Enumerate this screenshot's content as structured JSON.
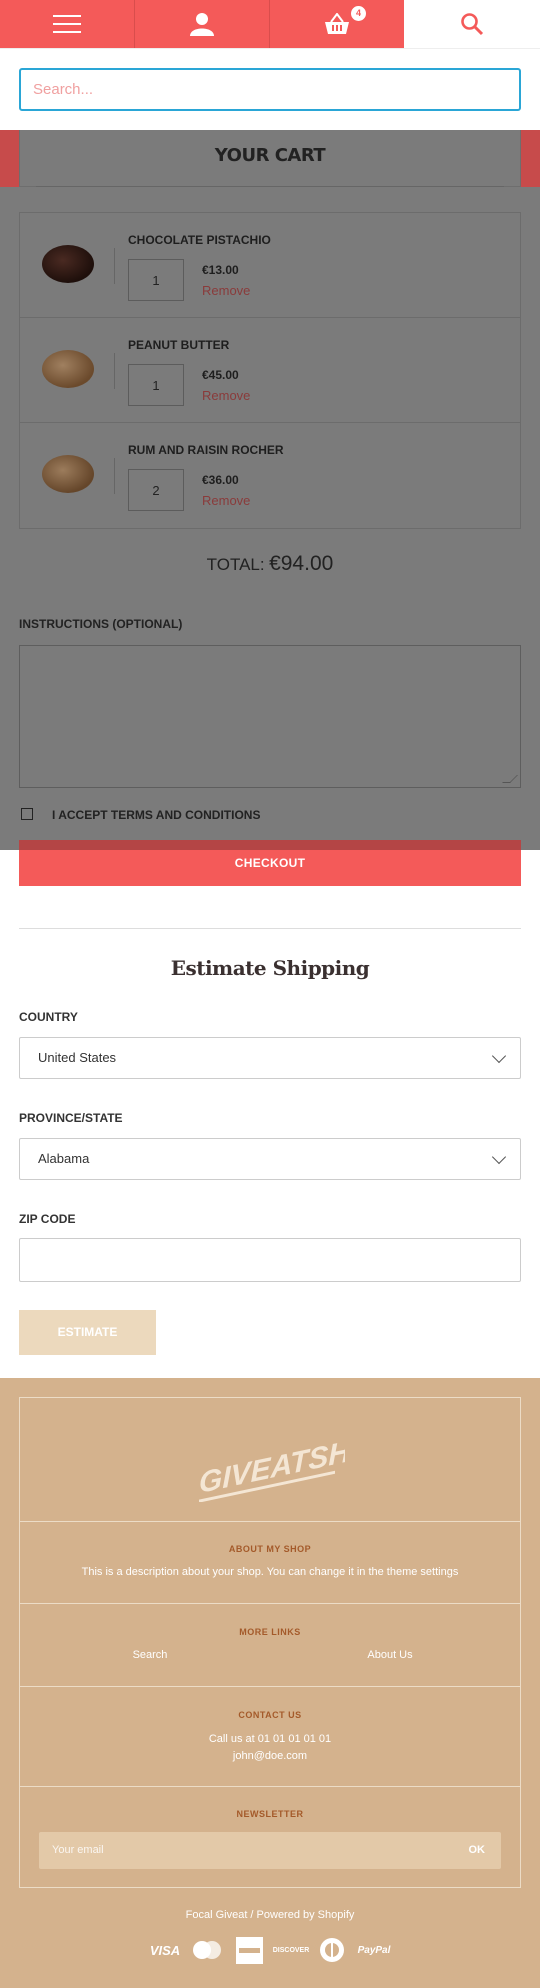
{
  "nav": {
    "cart_count": "4"
  },
  "search": {
    "placeholder": "Search..."
  },
  "cart": {
    "title": "YOUR CART",
    "items": [
      {
        "name": "CHOCOLATE PISTACHIO",
        "qty": "1",
        "price": "€13.00",
        "remove": "Remove"
      },
      {
        "name": "PEANUT BUTTER",
        "qty": "1",
        "price": "€45.00",
        "remove": "Remove"
      },
      {
        "name": "RUM AND RAISIN ROCHER",
        "qty": "2",
        "price": "€36.00",
        "remove": "Remove"
      }
    ],
    "total_label": "TOTAL:",
    "total_value": "€94.00",
    "instructions_label": "INSTRUCTIONS (OPTIONAL)",
    "terms_label": "I ACCEPT TERMS AND CONDITIONS",
    "checkout_label": "CHECKOUT"
  },
  "shipping": {
    "title": "Estimate Shipping",
    "country_label": "COUNTRY",
    "country_value": "United States",
    "province_label": "PROVINCE/STATE",
    "province_value": "Alabama",
    "zip_label": "ZIP CODE",
    "estimate_label": "ESTIMATE"
  },
  "footer": {
    "logo_text": "GIVEATSHOP",
    "about_title": "ABOUT MY SHOP",
    "about_text": "This is a description about your shop. You can change it in the theme settings",
    "links_title": "MORE LINKS",
    "link_search": "Search",
    "link_about": "About Us",
    "contact_title": "CONTACT US",
    "contact_phone": "Call us at 01 01 01 01 01",
    "contact_email": "john@doe.com",
    "newsletter_title": "NEWSLETTER",
    "newsletter_placeholder": "Your email",
    "newsletter_ok": "OK",
    "powered": "Focal Giveat / Powered by Shopify",
    "payments": [
      "VISA",
      "MasterCard",
      "AMERICAN EXPRESS",
      "DISCOVER",
      "Diners Club",
      "PayPal"
    ]
  },
  "colors": {
    "brand_red": "#f45a59",
    "footer_tan": "#d4b28d",
    "estimate_tan": "#ecd9bd"
  }
}
